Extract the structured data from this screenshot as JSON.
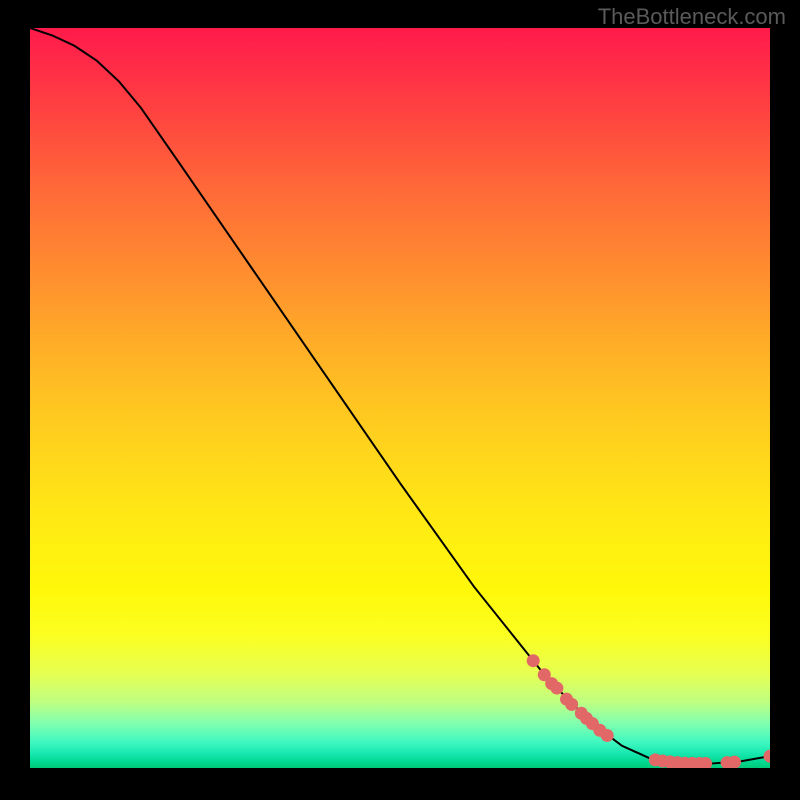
{
  "watermark": "TheBottleneck.com",
  "chart_data": {
    "type": "line",
    "title": "",
    "xlabel": "",
    "ylabel": "",
    "xlim": [
      0,
      100
    ],
    "ylim": [
      0,
      100
    ],
    "curve": [
      {
        "x": 0.0,
        "y": 100.0
      },
      {
        "x": 3.0,
        "y": 99.0
      },
      {
        "x": 6.0,
        "y": 97.6
      },
      {
        "x": 9.0,
        "y": 95.6
      },
      {
        "x": 12.0,
        "y": 92.8
      },
      {
        "x": 15.0,
        "y": 89.2
      },
      {
        "x": 20.0,
        "y": 82.0
      },
      {
        "x": 30.0,
        "y": 67.5
      },
      {
        "x": 40.0,
        "y": 53.0
      },
      {
        "x": 50.0,
        "y": 38.5
      },
      {
        "x": 60.0,
        "y": 24.5
      },
      {
        "x": 70.0,
        "y": 12.0
      },
      {
        "x": 76.0,
        "y": 6.0
      },
      {
        "x": 80.0,
        "y": 3.0
      },
      {
        "x": 84.0,
        "y": 1.2
      },
      {
        "x": 88.0,
        "y": 0.6
      },
      {
        "x": 92.0,
        "y": 0.6
      },
      {
        "x": 96.0,
        "y": 0.9
      },
      {
        "x": 100.0,
        "y": 1.6
      }
    ],
    "points": [
      {
        "x": 68.0,
        "y": 14.5
      },
      {
        "x": 69.5,
        "y": 12.6
      },
      {
        "x": 70.5,
        "y": 11.4
      },
      {
        "x": 71.2,
        "y": 10.8
      },
      {
        "x": 72.5,
        "y": 9.3
      },
      {
        "x": 73.2,
        "y": 8.6
      },
      {
        "x": 74.5,
        "y": 7.4
      },
      {
        "x": 75.2,
        "y": 6.7
      },
      {
        "x": 76.0,
        "y": 6.0
      },
      {
        "x": 77.0,
        "y": 5.1
      },
      {
        "x": 78.0,
        "y": 4.4
      },
      {
        "x": 84.5,
        "y": 1.1
      },
      {
        "x": 85.5,
        "y": 0.95
      },
      {
        "x": 86.5,
        "y": 0.82
      },
      {
        "x": 87.5,
        "y": 0.72
      },
      {
        "x": 88.5,
        "y": 0.65
      },
      {
        "x": 89.5,
        "y": 0.62
      },
      {
        "x": 90.5,
        "y": 0.6
      },
      {
        "x": 91.3,
        "y": 0.6
      },
      {
        "x": 94.2,
        "y": 0.72
      },
      {
        "x": 95.2,
        "y": 0.8
      },
      {
        "x": 100.0,
        "y": 1.6
      }
    ],
    "point_color": "#e26867",
    "line_color": "#000000"
  }
}
